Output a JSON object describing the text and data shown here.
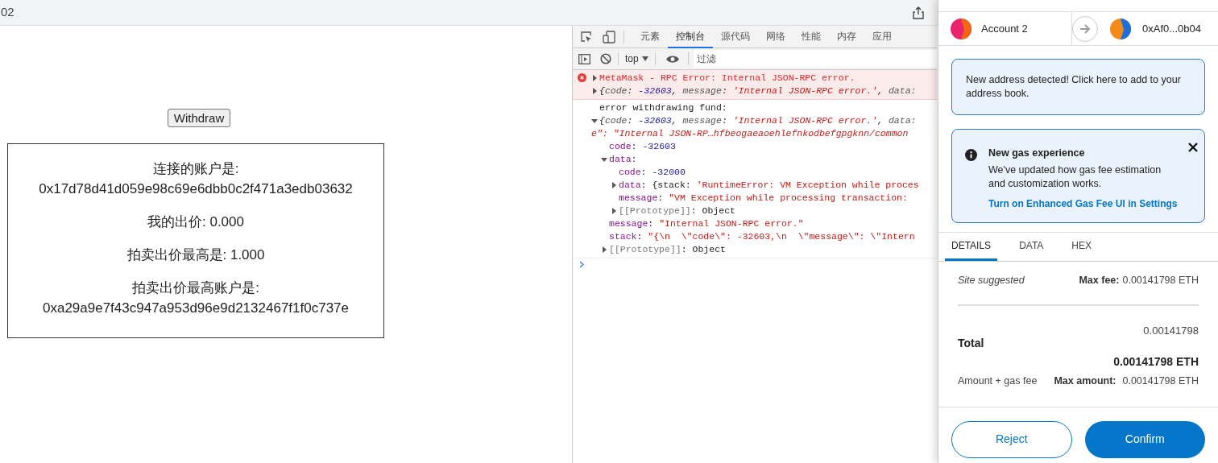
{
  "browser": {
    "address_fragment": "02"
  },
  "page": {
    "withdraw_button": "Withdraw",
    "paragraphs": [
      {
        "lines": [
          "连接的账户是:",
          "0x17d78d41d059e98c69e6dbb0c2f471a3edb03632"
        ]
      },
      {
        "lines": [
          "我的出价: 0.000"
        ]
      },
      {
        "lines": [
          "拍卖出价最高是: 1.000"
        ]
      },
      {
        "lines": [
          "拍卖出价最高账户是:",
          "0xa29a9e7f43c947a953d96e9d2132467f1f0c737e"
        ]
      }
    ]
  },
  "devtools": {
    "tabs": [
      {
        "label": "元素",
        "selected": false
      },
      {
        "label": "控制台",
        "selected": true
      },
      {
        "label": "源代码",
        "selected": false
      },
      {
        "label": "网络",
        "selected": false
      },
      {
        "label": "性能",
        "selected": false
      },
      {
        "label": "内存",
        "selected": false
      },
      {
        "label": "应用",
        "selected": false
      }
    ],
    "context": "top",
    "filter_placeholder": "过滤",
    "console": [
      {
        "kind": "error",
        "nodes": [
          {
            "expanded": false,
            "segs": [
              {
                "kind": "err",
                "text": "MetaMask - RPC Error: Internal JSON-RPC error."
              }
            ]
          },
          {
            "expanded": false,
            "italic": true,
            "segs": [
              {
                "kind": "text",
                "text": "{"
              },
              {
                "kind": "pkey",
                "text": "code"
              },
              {
                "kind": "text",
                "text": ": "
              },
              {
                "kind": "num",
                "text": "-32603"
              },
              {
                "kind": "text",
                "text": ", "
              },
              {
                "kind": "pkey",
                "text": "message"
              },
              {
                "kind": "text",
                "text": ": "
              },
              {
                "kind": "str",
                "text": "'Internal JSON-RPC error.'"
              },
              {
                "kind": "text",
                "text": ", "
              },
              {
                "kind": "pkey",
                "text": "data:"
              }
            ]
          }
        ]
      },
      {
        "kind": "log",
        "nodes": [
          {
            "segs": [
              {
                "kind": "text",
                "text": "error withdrawing fund:"
              }
            ]
          },
          {
            "expanded": true,
            "italic": true,
            "segs": [
              {
                "kind": "text",
                "text": "{"
              },
              {
                "kind": "pkey",
                "text": "code"
              },
              {
                "kind": "text",
                "text": ": "
              },
              {
                "kind": "num",
                "text": "-32603"
              },
              {
                "kind": "text",
                "text": ", "
              },
              {
                "kind": "pkey",
                "text": "message"
              },
              {
                "kind": "text",
                "text": ": "
              },
              {
                "kind": "str",
                "text": "'Internal JSON-RPC error.'"
              },
              {
                "kind": "text",
                "text": ", "
              },
              {
                "kind": "pkey",
                "text": "data:"
              }
            ],
            "wrap": [
              {
                "kind": "str",
                "text": "e\": \"Internal JSON-RP…hfbeogaeaoehlefnkodbefgpgknn/common"
              }
            ],
            "children": [
              {
                "segs": [
                  {
                    "kind": "key",
                    "text": "code"
                  },
                  {
                    "kind": "text",
                    "text": ": "
                  },
                  {
                    "kind": "num",
                    "text": "-32603"
                  }
                ]
              },
              {
                "expanded": true,
                "segs": [
                  {
                    "kind": "key",
                    "text": "data"
                  },
                  {
                    "kind": "text",
                    "text": ":"
                  }
                ],
                "children": [
                  {
                    "segs": [
                      {
                        "kind": "key",
                        "text": "code"
                      },
                      {
                        "kind": "text",
                        "text": ": "
                      },
                      {
                        "kind": "num",
                        "text": "-32000"
                      }
                    ]
                  },
                  {
                    "expanded": false,
                    "segs": [
                      {
                        "kind": "key",
                        "text": "data"
                      },
                      {
                        "kind": "text",
                        "text": ": {stack: "
                      },
                      {
                        "kind": "str",
                        "text": "'RuntimeError: VM Exception while proces"
                      }
                    ]
                  },
                  {
                    "segs": [
                      {
                        "kind": "key",
                        "text": "message"
                      },
                      {
                        "kind": "text",
                        "text": ": "
                      },
                      {
                        "kind": "str",
                        "text": "\"VM Exception while processing transaction:"
                      }
                    ]
                  },
                  {
                    "expanded": false,
                    "segs": [
                      {
                        "kind": "dim",
                        "text": "[[Prototype]]"
                      },
                      {
                        "kind": "text",
                        "text": ": Object"
                      }
                    ]
                  }
                ]
              },
              {
                "segs": [
                  {
                    "kind": "key",
                    "text": "message"
                  },
                  {
                    "kind": "text",
                    "text": ": "
                  },
                  {
                    "kind": "str",
                    "text": "\"Internal JSON-RPC error.\""
                  }
                ]
              },
              {
                "segs": [
                  {
                    "kind": "key",
                    "text": "stack"
                  },
                  {
                    "kind": "text",
                    "text": ": "
                  },
                  {
                    "kind": "str",
                    "text": "\"{\\n  \\\"code\\\": -32603,\\n  \\\"message\\\": \\\"Intern"
                  }
                ]
              },
              {
                "expanded": false,
                "segs": [
                  {
                    "kind": "dim",
                    "text": "[[Prototype]]"
                  },
                  {
                    "kind": "text",
                    "text": ": Object"
                  }
                ]
              }
            ]
          }
        ]
      },
      {
        "kind": "prompt"
      }
    ]
  },
  "metamask": {
    "from_account": "Account 2",
    "to_address": "0xAf0...0b04",
    "notices": [
      {
        "kind": "plain",
        "text": "New address detected! Click here to add to your address book."
      },
      {
        "kind": "info",
        "title": "New gas experience",
        "text": "We've updated how gas fee estimation and customization works.",
        "link": "Turn on Enhanced Gas Fee UI in Settings"
      }
    ],
    "tabs": [
      {
        "label": "DETAILS",
        "selected": true
      },
      {
        "label": "DATA",
        "selected": false
      },
      {
        "label": "HEX",
        "selected": false
      }
    ],
    "fee": {
      "note": "Site suggested",
      "max_label": "Max fee:",
      "max_value": "0.00141798 ETH"
    },
    "total": {
      "label": "Total",
      "amount": "0.00141798",
      "amount_eth": "0.00141798 ETH",
      "sub_label": "Amount + gas fee",
      "max_label": "Max amount:",
      "max_value": "0.00141798 ETH"
    },
    "buttons": {
      "reject": "Reject",
      "confirm": "Confirm"
    }
  }
}
